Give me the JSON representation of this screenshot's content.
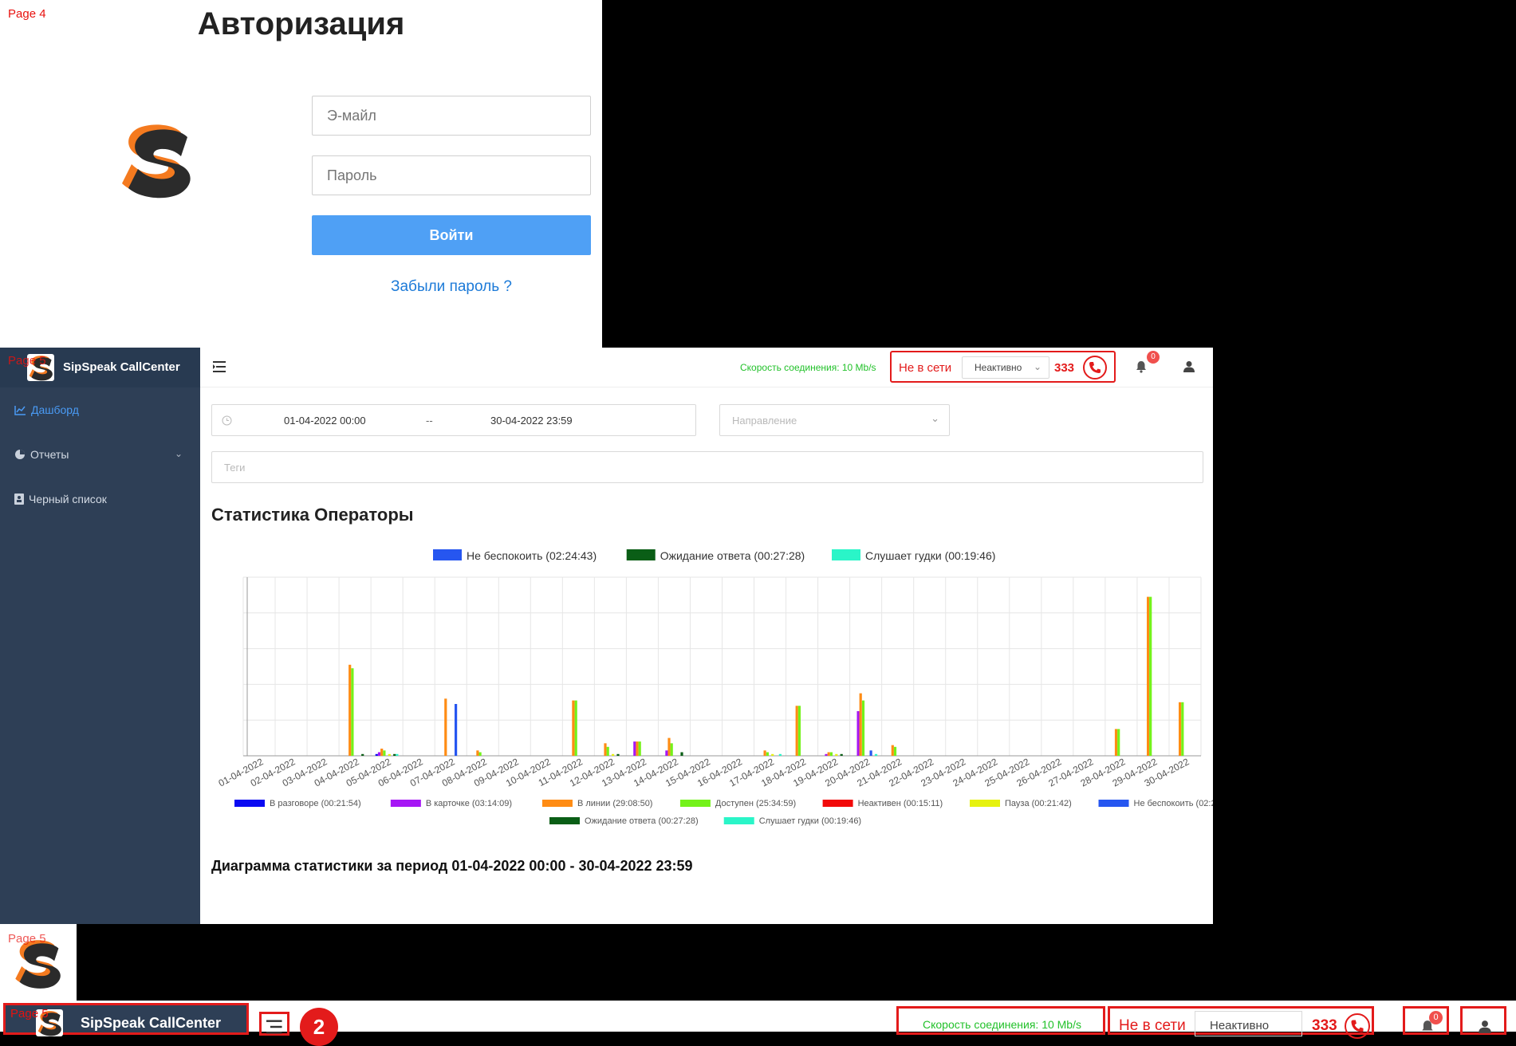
{
  "page_tags": {
    "login": "Page 4",
    "dashboard": "Page 5",
    "logo": "Page 5",
    "bottom": "Page 5"
  },
  "login": {
    "title": "Авторизация",
    "email_placeholder": "Э-майл",
    "password_placeholder": "Пароль",
    "submit_label": "Войти",
    "forgot_label": "Забыли пароль ?"
  },
  "brand": {
    "name": "SipSpeak CallCenter",
    "accent": "#f47a1f"
  },
  "sidebar": {
    "items": [
      {
        "label": "Дашборд",
        "icon": "line-chart-icon",
        "active": true
      },
      {
        "label": "Отчеты",
        "icon": "pie-chart-icon",
        "active": false
      },
      {
        "label": "Черный список",
        "icon": "contacts-book-icon",
        "active": false
      }
    ]
  },
  "topbar": {
    "speed": "Скорость соединения: 10 Mb/s",
    "status_offline": "Не в сети",
    "status_select": "Неактивно",
    "extension": "333",
    "notifications": "0"
  },
  "filters": {
    "date_start": "01-04-2022 00:00",
    "date_sep": "--",
    "date_end": "30-04-2022 23:59",
    "direction_placeholder": "Направление",
    "tags_placeholder": "Теги"
  },
  "section_title": "Статистика Операторы",
  "period_title": "Диаграмма статистики за период 01-04-2022 00:00 - 30-04-2022 23:59",
  "bottom_bar": {
    "callout": "2"
  },
  "chart_data": {
    "type": "bar",
    "categories": [
      "01-04-2022",
      "02-04-2022",
      "03-04-2022",
      "04-04-2022",
      "05-04-2022",
      "06-04-2022",
      "07-04-2022",
      "08-04-2022",
      "09-04-2022",
      "10-04-2022",
      "11-04-2022",
      "12-04-2022",
      "13-04-2022",
      "14-04-2022",
      "15-04-2022",
      "16-04-2022",
      "17-04-2022",
      "18-04-2022",
      "19-04-2022",
      "20-04-2022",
      "21-04-2022",
      "22-04-2022",
      "23-04-2022",
      "24-04-2022",
      "25-04-2022",
      "26-04-2022",
      "27-04-2022",
      "28-04-2022",
      "29-04-2022",
      "30-04-2022"
    ],
    "ylim": [
      0,
      100
    ],
    "grid": true,
    "legend_position": "top",
    "series": [
      {
        "name": "В разговоре (00:21:54)",
        "color": "#0a0af2",
        "values": [
          0,
          0,
          0,
          0,
          1,
          0,
          0,
          0,
          0,
          0,
          0,
          0,
          0,
          0,
          0,
          0,
          0,
          0,
          0,
          0,
          0,
          0,
          0,
          0,
          0,
          0,
          0,
          0,
          0,
          0
        ]
      },
      {
        "name": "В карточке (03:14:09)",
        "color": "#a616f5",
        "values": [
          0,
          0,
          0,
          0,
          2,
          0,
          0,
          0,
          0,
          0,
          0,
          0,
          8,
          3,
          0,
          0,
          0,
          0,
          1,
          25,
          0,
          0,
          0,
          0,
          0,
          0,
          0,
          0,
          0,
          0
        ]
      },
      {
        "name": "В линии (29:08:50)",
        "color": "#ff8c14",
        "values": [
          0,
          0,
          0,
          51,
          4,
          0,
          32,
          3,
          0,
          0,
          31,
          7,
          8,
          10,
          0,
          0,
          3,
          28,
          2,
          35,
          6,
          0,
          0,
          0,
          0,
          0,
          0,
          15,
          89,
          30
        ]
      },
      {
        "name": "Доступен (25:34:59)",
        "color": "#74f21a",
        "values": [
          0,
          0,
          0,
          49,
          3,
          0,
          0,
          2,
          0,
          0,
          31,
          5,
          8,
          7,
          0,
          0,
          2,
          28,
          2,
          31,
          5,
          0,
          0,
          0,
          0,
          0,
          0,
          15,
          89,
          30
        ]
      },
      {
        "name": "Неактивен (00:15:11)",
        "color": "#f20a0a",
        "values": [
          0,
          0,
          0,
          0,
          0,
          0,
          0,
          0,
          0,
          0,
          0,
          0,
          0,
          0,
          0,
          0,
          0,
          0,
          0,
          0,
          0,
          0,
          0,
          0,
          0,
          0,
          0,
          0,
          0,
          0
        ]
      },
      {
        "name": "Пауза (00:21:42)",
        "color": "#e6f20f",
        "values": [
          0,
          0,
          0,
          0,
          1,
          0,
          0,
          0,
          0,
          0,
          0,
          1,
          0,
          0,
          0,
          0,
          1,
          0,
          1,
          0,
          0,
          0,
          0,
          0,
          0,
          0,
          0,
          0,
          0,
          0
        ]
      },
      {
        "name": "Не беспокоить (02:24:43)",
        "color": "#2656f0",
        "values": [
          0,
          0,
          0,
          0,
          0,
          0,
          29,
          0,
          0,
          0,
          0,
          0,
          0,
          0,
          0,
          0,
          0,
          0,
          0,
          3,
          0,
          0,
          0,
          0,
          0,
          0,
          0,
          0,
          0,
          0
        ]
      },
      {
        "name": "Ожидание ответа (00:27:28)",
        "color": "#0a5e16",
        "values": [
          0,
          0,
          0,
          1,
          1,
          0,
          0,
          0,
          0,
          0,
          0,
          1,
          0,
          2,
          0,
          0,
          0,
          0,
          1,
          0,
          0,
          0,
          0,
          0,
          0,
          0,
          0,
          0,
          0,
          0
        ]
      },
      {
        "name": "Слушает гудки (00:19:46)",
        "color": "#2af5c8",
        "values": [
          0,
          0,
          0,
          0,
          1,
          0,
          0,
          0,
          0,
          0,
          0,
          0,
          0,
          0,
          0,
          0,
          1,
          0,
          0,
          1,
          0,
          0,
          0,
          0,
          0,
          0,
          0,
          0,
          0,
          0
        ]
      }
    ]
  }
}
